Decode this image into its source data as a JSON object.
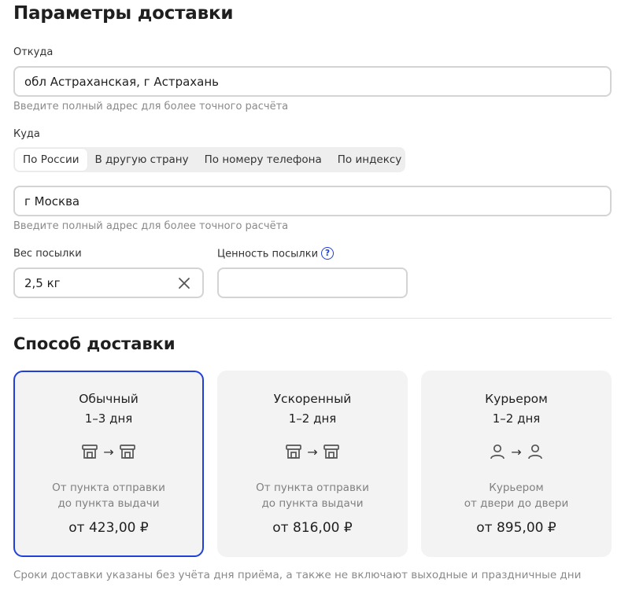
{
  "section_title": "Параметры доставки",
  "from": {
    "label": "Откуда",
    "value": "обл Астраханская, г Астрахань",
    "hint": "Введите полный адрес для более точного расчёта"
  },
  "to": {
    "label": "Куда",
    "tabs": [
      {
        "label": "По России",
        "active": true
      },
      {
        "label": "В другую страну",
        "active": false
      },
      {
        "label": "По номеру телефона",
        "active": false
      },
      {
        "label": "По индексу",
        "active": false
      }
    ],
    "value": "г Москва",
    "hint": "Введите полный адрес для более точного расчёта"
  },
  "weight": {
    "label": "Вес посылки",
    "value": "2,5 кг",
    "clear_icon": "close-icon"
  },
  "value_field": {
    "label": "Ценность посылки",
    "value": "",
    "help_icon": "question-circle-icon"
  },
  "delivery": {
    "title": "Способ доставки",
    "options": [
      {
        "title": "Обычный",
        "days": "1–3 дня",
        "icon": "pickup-point-icon",
        "desc1": "От пункта отправки",
        "desc2": "до пункта выдачи",
        "price": "от 423,00 ₽",
        "selected": true
      },
      {
        "title": "Ускоренный",
        "days": "1–2 дня",
        "icon": "pickup-point-icon",
        "desc1": "От пункта отправки",
        "desc2": "до пункта выдачи",
        "price": "от 816,00 ₽",
        "selected": false
      },
      {
        "title": "Курьером",
        "days": "1–2 дня",
        "icon": "person-icon",
        "desc1": "Курьером",
        "desc2": "от двери до двери",
        "price": "от 895,00 ₽",
        "selected": false
      }
    ],
    "arrow": "→"
  },
  "footer_note": "Сроки доставки указаны без учёта дня приёма, а также не включают выходные и праздничные дни",
  "colors": {
    "accent": "#2140d8",
    "card_bg": "#f3f3f3",
    "border": "#d4d4d4",
    "hint": "#8a8a8a"
  }
}
